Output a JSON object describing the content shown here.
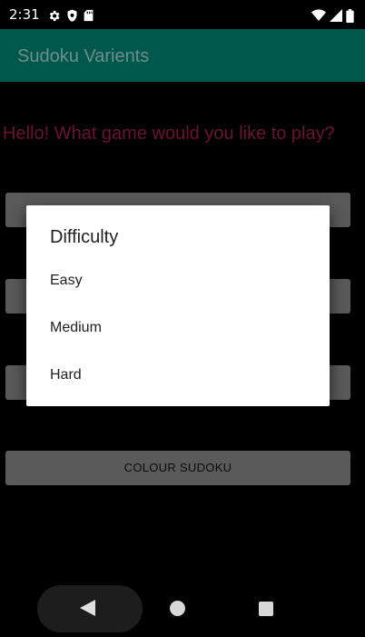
{
  "status_bar": {
    "time": "2:31",
    "left_icons": [
      "settings-icon",
      "shield-icon",
      "sd-card-icon"
    ],
    "right_icons": [
      "wifi-icon",
      "signal-icon",
      "battery-icon"
    ]
  },
  "app_bar": {
    "title": "Sudoku Varients",
    "color": "#00574b"
  },
  "main": {
    "greeting": "Hello! What game would you like to play?",
    "greeting_color": "#6b1136",
    "buttons": [
      {
        "label": ""
      },
      {
        "label": ""
      },
      {
        "label": ""
      },
      {
        "label": "COLOUR SUDOKU"
      }
    ]
  },
  "dialog": {
    "title": "Difficulty",
    "options": [
      "Easy",
      "Medium",
      "Hard"
    ]
  },
  "nav_bar": {
    "icons": [
      "back-icon",
      "home-icon",
      "recents-icon"
    ]
  }
}
